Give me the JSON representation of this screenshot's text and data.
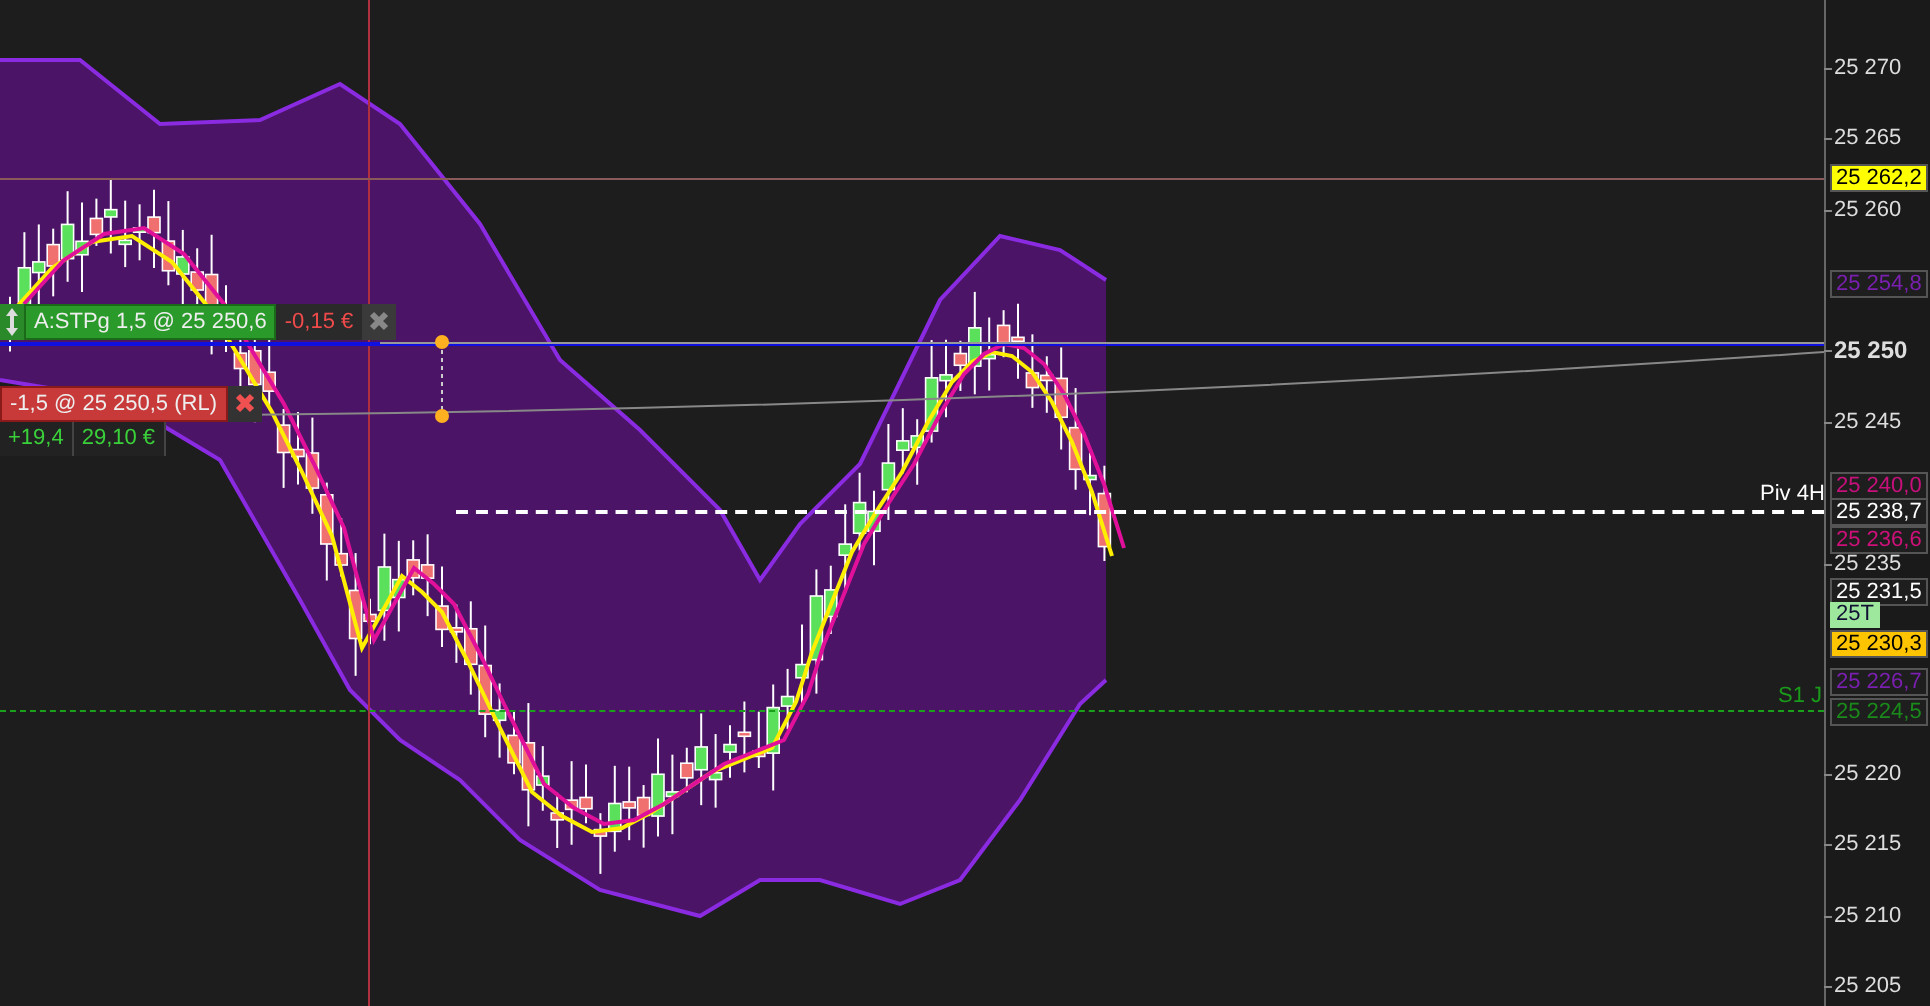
{
  "price_axis": {
    "ticks": [
      {
        "label": "25 270",
        "bold": false
      },
      {
        "label": "25 265",
        "bold": false
      },
      {
        "label": "25 260",
        "bold": false
      },
      {
        "label": "25 250",
        "bold": true
      },
      {
        "label": "25 245",
        "bold": false
      },
      {
        "label": "25 235",
        "bold": false
      },
      {
        "label": "25 220",
        "bold": false
      },
      {
        "label": "25 215",
        "bold": false
      },
      {
        "label": "25 210",
        "bold": false
      },
      {
        "label": "25 205",
        "bold": false
      }
    ]
  },
  "price_labels": [
    {
      "text": "25 262,2",
      "kind": "highlight",
      "color": "#ffff00"
    },
    {
      "text": "25 254,8",
      "kind": "boxed",
      "color": "#7a1fb0"
    },
    {
      "text": "25 240,0",
      "kind": "boxed",
      "color": "#c8107c"
    },
    {
      "text": "25 238,7",
      "kind": "boxed",
      "color": "#ffffff"
    },
    {
      "text": "25 236,6",
      "kind": "boxed",
      "color": "#d0107a"
    },
    {
      "text": "25 231,5",
      "kind": "boxed",
      "color": "#ffffff"
    },
    {
      "text": "25 230,3",
      "kind": "highlight",
      "color": "#ffc400"
    },
    {
      "text": "25 226,7",
      "kind": "boxed",
      "color": "#7a1fb0"
    },
    {
      "text": "25 224,5",
      "kind": "boxed",
      "color": "#1a8a1a"
    }
  ],
  "tick_badge": "25T",
  "levels": [
    {
      "kind": "pivot",
      "label": "Piv 4H"
    },
    {
      "kind": "support",
      "label": "S1 J"
    }
  ],
  "orders": [
    {
      "kind": "stop",
      "label": "A:STPg 1,5 @ 25 250,6",
      "pnl": "-0,15 €"
    },
    {
      "kind": "limit",
      "label": "-1,5 @ 25 250,5 (RL)"
    }
  ],
  "position": {
    "points": "+19,4",
    "profit": "29,10 €"
  }
}
